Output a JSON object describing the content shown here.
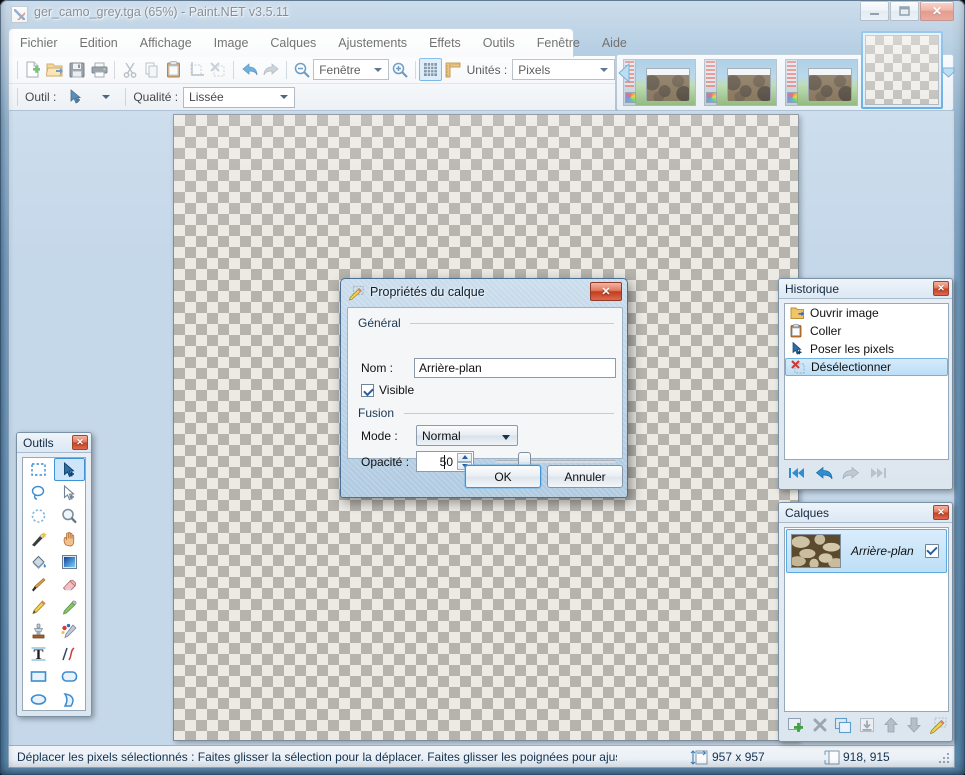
{
  "window": {
    "title": "ger_camo_grey.tga (65%) - Paint.NET v3.5.11",
    "min_label": "—",
    "max_label": "□",
    "close_label": "✕",
    "icon": "paintnet-icon"
  },
  "menu": {
    "items": [
      {
        "label": "Fichier",
        "name": "menu-fichier"
      },
      {
        "label": "Edition",
        "name": "menu-edition"
      },
      {
        "label": "Affichage",
        "name": "menu-affichage"
      },
      {
        "label": "Image",
        "name": "menu-image"
      },
      {
        "label": "Calques",
        "name": "menu-calques"
      },
      {
        "label": "Ajustements",
        "name": "menu-ajustements"
      },
      {
        "label": "Effets",
        "name": "menu-effets"
      },
      {
        "label": "Outils",
        "name": "menu-outils"
      },
      {
        "label": "Fenêtre",
        "name": "menu-fenetre"
      },
      {
        "label": "Aide",
        "name": "menu-aide"
      }
    ]
  },
  "toolbar": {
    "buttons": [
      {
        "name": "new-icon",
        "tooltip": "Nouveau"
      },
      {
        "name": "open-icon",
        "tooltip": "Ouvrir"
      },
      {
        "name": "save-icon",
        "tooltip": "Enregistrer"
      },
      {
        "name": "print-icon",
        "tooltip": "Imprimer"
      },
      {
        "name": "cut-icon",
        "tooltip": "Couper"
      },
      {
        "name": "copy-icon",
        "tooltip": "Copier"
      },
      {
        "name": "paste-icon",
        "tooltip": "Coller"
      },
      {
        "name": "crop-icon",
        "tooltip": "Rogner"
      },
      {
        "name": "deselect-icon",
        "tooltip": "Désélectionner"
      },
      {
        "name": "undo-icon",
        "tooltip": "Annuler"
      },
      {
        "name": "redo-icon",
        "tooltip": "Rétablir"
      }
    ],
    "zoom_out_icon": "zoom-out-icon",
    "zoom_in_icon": "zoom-in-icon",
    "zoom_value": "Fenêtre",
    "grid_icon": "grid-icon",
    "ruler_icon": "ruler-icon",
    "units_label": "Unités :",
    "units_value": "Pixels",
    "tool_label": "Outil :",
    "tool_icon": "move-selected-pixels-icon",
    "quality_label": "Qualité :",
    "quality_value": "Lissée"
  },
  "thumbnails": {
    "items": [
      {
        "name": "thumbnail-1",
        "kind": "screenshot"
      },
      {
        "name": "thumbnail-2",
        "kind": "screenshot"
      },
      {
        "name": "thumbnail-3",
        "kind": "screenshot"
      },
      {
        "name": "thumbnail-4",
        "kind": "transparent",
        "selected": true
      }
    ]
  },
  "dialog": {
    "title": "Propriétés du calque",
    "icon": "layer-properties-icon",
    "close_label": "✕",
    "group_general": "Général",
    "name_label": "Nom :",
    "name_value": "Arrière-plan",
    "visible_label": "Visible",
    "visible_checked": true,
    "group_fusion": "Fusion",
    "mode_label": "Mode :",
    "mode_value": "Normal",
    "opacity_label": "Opacité :",
    "opacity_value": "50",
    "opacity_min": 0,
    "opacity_max": 255,
    "ok_label": "OK",
    "cancel_label": "Annuler"
  },
  "tools_panel": {
    "title": "Outils",
    "close_label": "✕",
    "selected_index": 1,
    "items": [
      {
        "name": "rectangle-select-icon",
        "label": "Sélection rectangulaire"
      },
      {
        "name": "move-selected-pixels-icon",
        "label": "Déplacer les pixels sélectionnés"
      },
      {
        "name": "lasso-select-icon",
        "label": "Lasso"
      },
      {
        "name": "move-selection-icon",
        "label": "Déplacer la sélection"
      },
      {
        "name": "ellipse-select-icon",
        "label": "Sélection ellipse"
      },
      {
        "name": "zoom-icon",
        "label": "Zoom"
      },
      {
        "name": "magic-wand-icon",
        "label": "Baguette magique"
      },
      {
        "name": "pan-icon",
        "label": "Panoramique"
      },
      {
        "name": "paint-bucket-icon",
        "label": "Pot de peinture"
      },
      {
        "name": "gradient-icon",
        "label": "Dégradé"
      },
      {
        "name": "paintbrush-icon",
        "label": "Pinceau"
      },
      {
        "name": "eraser-icon",
        "label": "Gomme"
      },
      {
        "name": "pencil-icon",
        "label": "Crayon"
      },
      {
        "name": "color-picker-icon",
        "label": "Pipette"
      },
      {
        "name": "clone-stamp-icon",
        "label": "Tampon de clonage"
      },
      {
        "name": "recolor-icon",
        "label": "Recolorier"
      },
      {
        "name": "text-icon",
        "label": "Texte"
      },
      {
        "name": "line-curve-icon",
        "label": "Ligne / Courbe"
      },
      {
        "name": "rectangle-shape-icon",
        "label": "Rectangle"
      },
      {
        "name": "rounded-rectangle-icon",
        "label": "Rectangle arrondi"
      },
      {
        "name": "ellipse-shape-icon",
        "label": "Ellipse"
      },
      {
        "name": "freeform-shape-icon",
        "label": "Forme libre"
      }
    ]
  },
  "history_panel": {
    "title": "Historique",
    "close_label": "✕",
    "items": [
      {
        "label": "Ouvrir image",
        "icon": "open-image-icon",
        "selected": false
      },
      {
        "label": "Coller",
        "icon": "paste-icon",
        "selected": false
      },
      {
        "label": "Poser les pixels",
        "icon": "finish-pixels-icon",
        "selected": false
      },
      {
        "label": "Désélectionner",
        "icon": "deselect-icon",
        "selected": true
      }
    ],
    "buttons": [
      {
        "name": "history-rewind-button",
        "icon": "rewind-icon",
        "enabled": true
      },
      {
        "name": "history-undo-button",
        "icon": "undo-icon",
        "enabled": true
      },
      {
        "name": "history-redo-button",
        "icon": "redo-icon",
        "enabled": false
      },
      {
        "name": "history-forward-button",
        "icon": "fast-forward-icon",
        "enabled": false
      }
    ]
  },
  "layers_panel": {
    "title": "Calques",
    "close_label": "✕",
    "layers": [
      {
        "name": "Arrière-plan",
        "visible": true,
        "selected": true
      }
    ],
    "buttons": [
      {
        "name": "add-layer-button",
        "icon": "add-layer-icon",
        "enabled": true
      },
      {
        "name": "delete-layer-button",
        "icon": "delete-layer-icon",
        "enabled": true
      },
      {
        "name": "duplicate-layer-button",
        "icon": "duplicate-layer-icon",
        "enabled": true
      },
      {
        "name": "merge-layer-down-button",
        "icon": "merge-down-icon",
        "enabled": false
      },
      {
        "name": "move-layer-up-button",
        "icon": "arrow-up-icon",
        "enabled": true
      },
      {
        "name": "move-layer-down-button",
        "icon": "arrow-down-icon",
        "enabled": true
      },
      {
        "name": "layer-properties-button",
        "icon": "layer-properties-icon",
        "enabled": true
      }
    ]
  },
  "statusbar": {
    "help_text": "Déplacer les pixels sélectionnés : Faites glisser la sélection pour la déplacer. Faites glisser les poignées pour ajuster l'échelle. Fai",
    "image_size": "957 x 957",
    "cursor_position": "918, 915",
    "size_icon": "image-size-icon",
    "position_icon": "cursor-position-icon"
  },
  "colors": {
    "accent": "#4a9ede",
    "titlebar_start": "#8fb4d4",
    "titlebar_end": "#5c8cb3",
    "close_red": "#c5351c",
    "selection_blue": "#bcdef6"
  }
}
